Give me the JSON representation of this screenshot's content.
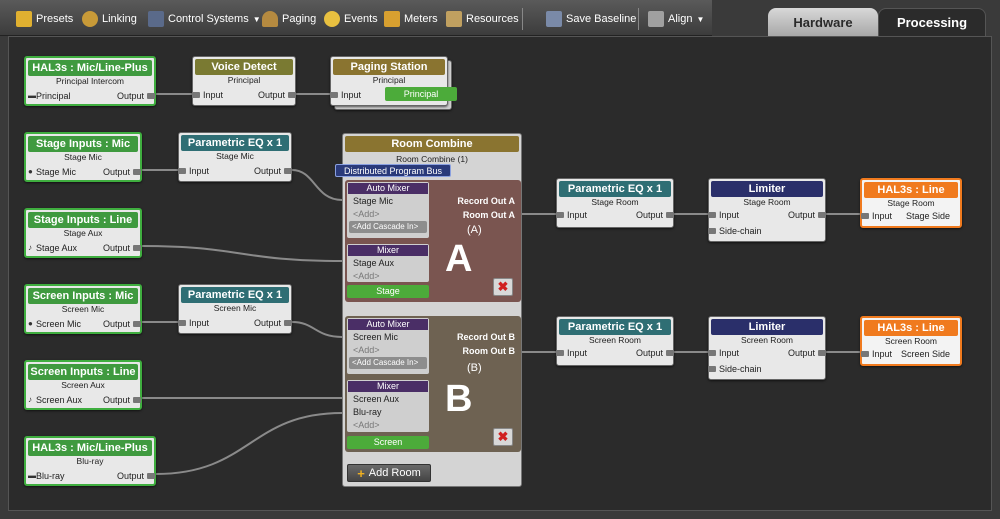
{
  "toolbar": {
    "presets": "Presets",
    "linking": "Linking",
    "control_systems": "Control Systems",
    "paging": "Paging",
    "events": "Events",
    "meters": "Meters",
    "resources": "Resources",
    "save_baseline": "Save Baseline",
    "align": "Align"
  },
  "tabs": {
    "hardware": "Hardware",
    "processing": "Processing"
  },
  "blocks": {
    "hal_principal": {
      "title": "HAL3s : Mic/Line-Plus",
      "sub": "Principal Intercom",
      "left": "Principal",
      "right": "Output"
    },
    "voice_detect": {
      "title": "Voice Detect",
      "sub": "Principal",
      "left": "Input",
      "right": "Output"
    },
    "paging_station": {
      "title": "Paging Station",
      "sub": "Principal",
      "left": "Input",
      "tag": "Principal"
    },
    "stage_mic": {
      "title": "Stage Inputs : Mic",
      "sub": "Stage Mic",
      "left": "Stage Mic",
      "right": "Output"
    },
    "peq_stage_mic": {
      "title": "Parametric EQ x 1",
      "sub": "Stage Mic",
      "left": "Input",
      "right": "Output"
    },
    "stage_line": {
      "title": "Stage Inputs : Line",
      "sub": "Stage Aux",
      "left": "Stage Aux",
      "right": "Output"
    },
    "screen_mic": {
      "title": "Screen Inputs : Mic",
      "sub": "Screen Mic",
      "left": "Screen Mic",
      "right": "Output"
    },
    "peq_screen_mic": {
      "title": "Parametric EQ x 1",
      "sub": "Screen Mic",
      "left": "Input",
      "right": "Output"
    },
    "screen_line": {
      "title": "Screen Inputs : Line",
      "sub": "Screen Aux",
      "left": "Screen Aux",
      "right": "Output"
    },
    "hal_bluray": {
      "title": "HAL3s : Mic/Line-Plus",
      "sub": "Blu-ray",
      "left": "Blu-ray",
      "right": "Output"
    },
    "peq_stage_room": {
      "title": "Parametric EQ x 1",
      "sub": "Stage Room",
      "left": "Input",
      "right": "Output"
    },
    "limiter_stage": {
      "title": "Limiter",
      "sub": "Stage Room",
      "left": "Input",
      "right": "Output",
      "left2": "Side-chain"
    },
    "hal_line_stage": {
      "title": "HAL3s : Line",
      "sub": "Stage Room",
      "left": "Input",
      "right": "Stage Side"
    },
    "peq_screen_room": {
      "title": "Parametric EQ x 1",
      "sub": "Screen Room",
      "left": "Input",
      "right": "Output"
    },
    "limiter_screen": {
      "title": "Limiter",
      "sub": "Screen Room",
      "left": "Input",
      "right": "Output",
      "left2": "Side-chain"
    },
    "hal_line_screen": {
      "title": "HAL3s : Line",
      "sub": "Screen Room",
      "left": "Input",
      "right": "Screen Side"
    }
  },
  "room_combine": {
    "title": "Room Combine",
    "sub": "Room Combine (1)",
    "bus": "Distributed Program Bus",
    "add_room": "Add Room",
    "room_a": {
      "auto_mixer": "Auto Mixer",
      "am_in1": "Stage Mic",
      "am_add": "<Add>",
      "cascade": "<Add Cascade In>",
      "mixer": "Mixer",
      "mx_in1": "Stage Aux",
      "mx_add": "<Add>",
      "name": "Stage",
      "letter": "A",
      "paren": "(A)",
      "rec": "Record Out A",
      "room": "Room Out A"
    },
    "room_b": {
      "auto_mixer": "Auto Mixer",
      "am_in1": "Screen Mic",
      "am_add": "<Add>",
      "cascade": "<Add Cascade In>",
      "mixer": "Mixer",
      "mx_in1": "Screen Aux",
      "mx_in2": "Blu-ray",
      "mx_add": "<Add>",
      "name": "Screen",
      "letter": "B",
      "paren": "(B)",
      "rec": "Record Out B",
      "room": "Room Out B"
    }
  },
  "colors": {
    "green": "#3f9a3f",
    "teal": "#2f6e74",
    "olive": "#7a7a32",
    "navy": "#2a2f6a",
    "orange": "#f07a1e",
    "room_a": "#7a5550",
    "room_b": "#6e6252"
  }
}
